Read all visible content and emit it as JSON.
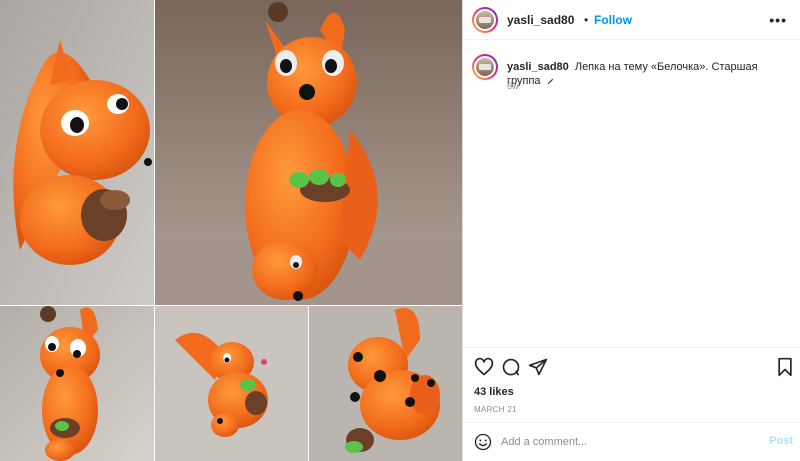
{
  "post": {
    "username": "yasli_sad80",
    "follow_label": "Follow",
    "separator": "•",
    "more_label": "•••",
    "caption": {
      "username": "yasli_sad80",
      "text": "Лепка на тему «Белочка». Старшая группа",
      "time_ago": "6w"
    },
    "likes": "43 likes",
    "date": "MARCH 21",
    "comment_placeholder": "Add a comment...",
    "post_label": "Post"
  },
  "icons": {
    "like": "heart-icon",
    "comment": "comment-icon",
    "share": "paper-plane-icon",
    "save": "bookmark-icon",
    "emoji": "emoji-icon",
    "more": "more-icon"
  },
  "colors": {
    "accent": "#0095f6",
    "post_disabled": "#b2dffc",
    "plasticine_orange": "#f26a1b"
  }
}
